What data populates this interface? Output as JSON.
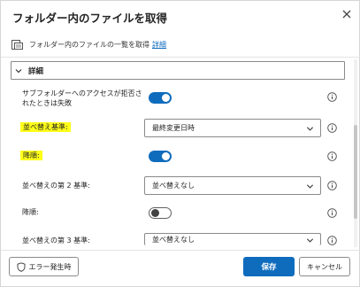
{
  "dialog": {
    "title": "フォルダー内のファイルを取得",
    "close_icon": "close-icon"
  },
  "description": {
    "text": "フォルダー内のファイルの一覧を取得",
    "link": "詳細",
    "icon": "folder-list-icon"
  },
  "details": {
    "section_label": "詳細",
    "expanded": true,
    "rows": [
      {
        "label": "サブフォルダーへのアクセスが拒否されたときは失敗",
        "control": "toggle",
        "state": "on"
      },
      {
        "label": "並べ替え基準:",
        "highlighted": true,
        "control": "select",
        "value": "最終変更日時"
      },
      {
        "label": "降順:",
        "highlighted": true,
        "control": "toggle",
        "state": "on"
      },
      {
        "label": "並べ替えの第 2 基準:",
        "control": "select",
        "value": "並べ替えなし"
      },
      {
        "label": "降順:",
        "control": "toggle",
        "state": "off"
      },
      {
        "label": "並べ替えの第 3 基準:",
        "control": "select",
        "value": "並べ替えなし"
      }
    ]
  },
  "footer": {
    "on_error_label": "エラー発生時",
    "save_label": "保存",
    "cancel_label": "キャンセル"
  },
  "colors": {
    "accent": "#0f6cbd",
    "highlight": "#ffff1a"
  }
}
